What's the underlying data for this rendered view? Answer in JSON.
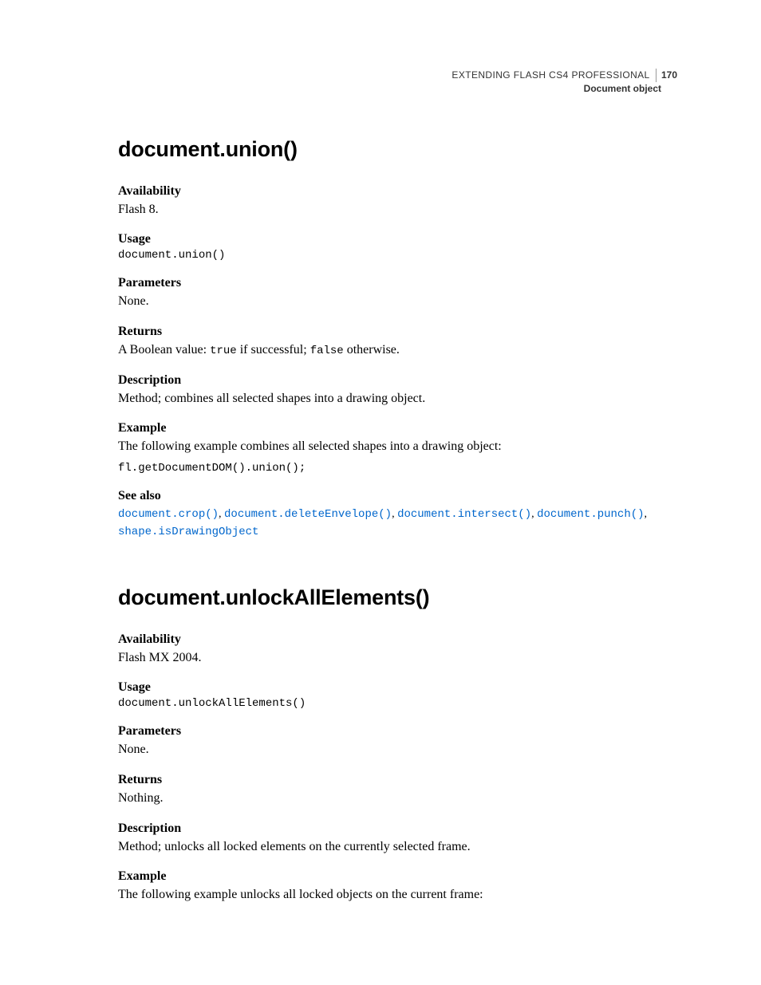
{
  "header": {
    "breadcrumb": "EXTENDING FLASH CS4 PROFESSIONAL",
    "page_number": "170",
    "section": "Document object"
  },
  "entries": [
    {
      "title": "document.union()",
      "availability_label": "Availability",
      "availability_text": "Flash 8.",
      "usage_label": "Usage",
      "usage_code": "document.union()",
      "parameters_label": "Parameters",
      "parameters_text": "None.",
      "returns_label": "Returns",
      "returns_pre": "A Boolean value: ",
      "returns_code1": "true",
      "returns_mid": " if successful; ",
      "returns_code2": "false",
      "returns_post": " otherwise.",
      "description_label": "Description",
      "description_text": "Method; combines all selected shapes into a drawing object.",
      "example_label": "Example",
      "example_text": "The following example combines all selected shapes into a drawing object:",
      "example_code": "fl.getDocumentDOM().union();",
      "seealso_label": "See also",
      "seealso_links": [
        "document.crop()",
        "document.deleteEnvelope()",
        "document.intersect()",
        "document.punch()",
        "shape.isDrawingObject"
      ]
    },
    {
      "title": "document.unlockAllElements()",
      "availability_label": "Availability",
      "availability_text": "Flash MX 2004.",
      "usage_label": "Usage",
      "usage_code": "document.unlockAllElements()",
      "parameters_label": "Parameters",
      "parameters_text": "None.",
      "returns_label": "Returns",
      "returns_text": "Nothing.",
      "description_label": "Description",
      "description_text": "Method; unlocks all locked elements on the currently selected frame.",
      "example_label": "Example",
      "example_text": "The following example unlocks all locked objects on the current frame:"
    }
  ]
}
